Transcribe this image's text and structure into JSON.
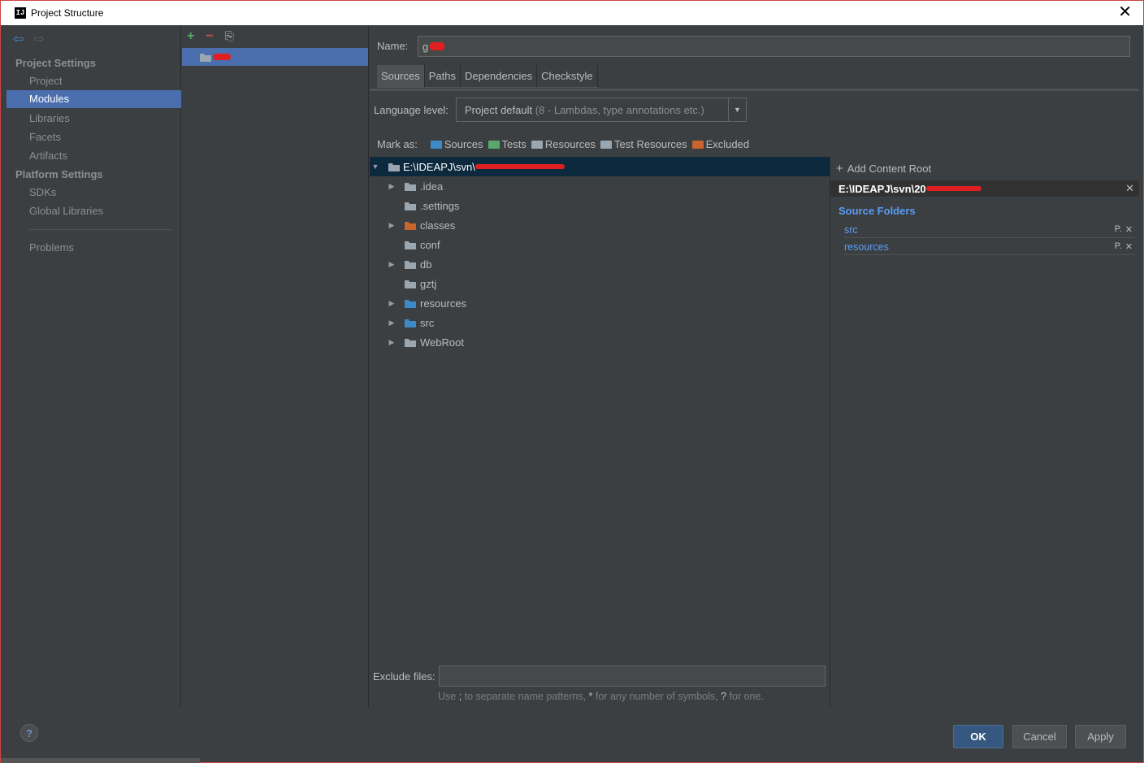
{
  "window": {
    "title": "Project Structure",
    "app_icon": "IJ"
  },
  "sidebar": {
    "section_project": "Project Settings",
    "project_items": [
      "Project",
      "Modules",
      "Libraries",
      "Facets",
      "Artifacts"
    ],
    "selected": "Modules",
    "section_platform": "Platform Settings",
    "platform_items": [
      "SDKs",
      "Global Libraries"
    ],
    "problems": "Problems"
  },
  "module_list": {
    "module_name_visible": ""
  },
  "name_field": {
    "label": "Name:",
    "value": "g"
  },
  "tabs": [
    "Sources",
    "Paths",
    "Dependencies",
    "Checkstyle"
  ],
  "active_tab": "Sources",
  "language_level": {
    "label": "Language level:",
    "value_main": "Project default",
    "value_dim": "(8 - Lambdas, type annotations etc.)"
  },
  "mark_as": {
    "label": "Mark as:",
    "items": [
      {
        "label": "Sources",
        "color": "#3d8ac7"
      },
      {
        "label": "Tests",
        "color": "#59a869"
      },
      {
        "label": "Resources",
        "color": "#9aa7b0"
      },
      {
        "label": "Test Resources",
        "color": "#9aa7b0"
      },
      {
        "label": "Excluded",
        "color": "#c8642e"
      }
    ]
  },
  "tree": {
    "root": "E:\\IDEAPJ\\svn\\",
    "children": [
      {
        "label": ".idea",
        "expandable": true,
        "color": "#9aa7b0"
      },
      {
        "label": ".settings",
        "expandable": false,
        "color": "#9aa7b0"
      },
      {
        "label": "classes",
        "expandable": true,
        "color": "#c8642e"
      },
      {
        "label": "conf",
        "expandable": false,
        "color": "#9aa7b0"
      },
      {
        "label": "db",
        "expandable": true,
        "color": "#9aa7b0"
      },
      {
        "label": "gztj",
        "expandable": false,
        "color": "#9aa7b0"
      },
      {
        "label": "resources",
        "expandable": true,
        "color": "#3d8ac7"
      },
      {
        "label": "src",
        "expandable": true,
        "color": "#3d8ac7"
      },
      {
        "label": "WebRoot",
        "expandable": true,
        "color": "#9aa7b0"
      }
    ]
  },
  "exclude": {
    "label": "Exclude files:",
    "hint_a": "Use ",
    "hint_semicolon": ";",
    "hint_b": " to separate name patterns, ",
    "hint_star": "*",
    "hint_c": " for any number of symbols, ",
    "hint_q": "?",
    "hint_d": " for one."
  },
  "content_root": {
    "add_label": "Add Content Root",
    "root_path": "E:\\IDEAPJ\\svn\\20",
    "source_folders_title": "Source Folders",
    "source_folders": [
      "src",
      "resources"
    ]
  },
  "buttons": {
    "ok": "OK",
    "cancel": "Cancel",
    "apply": "Apply",
    "help": "?"
  }
}
